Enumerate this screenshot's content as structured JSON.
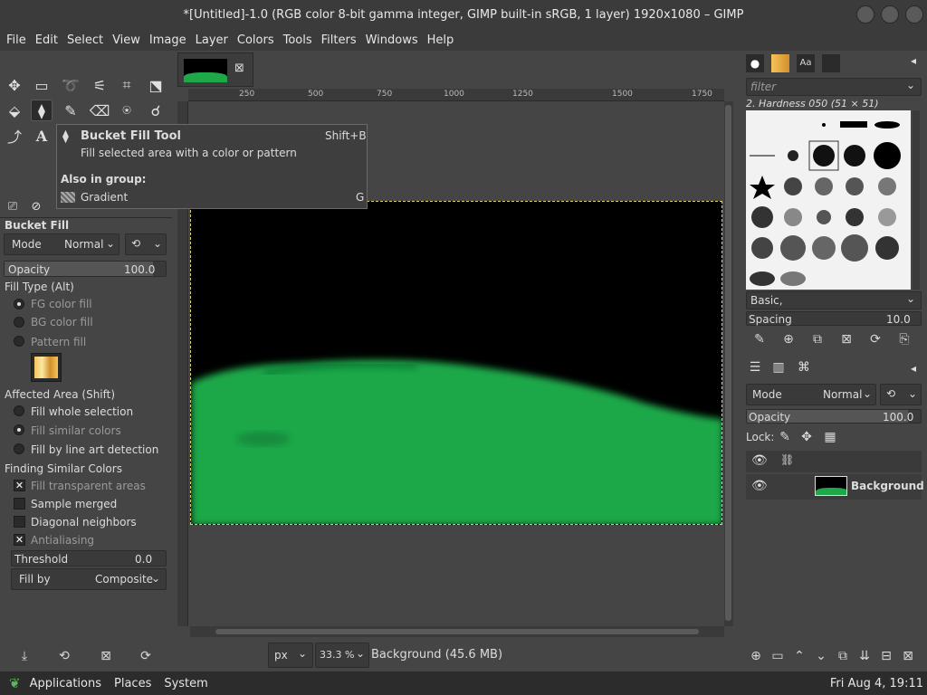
{
  "window": {
    "title": "*[Untitled]-1.0 (RGB color 8-bit gamma integer, GIMP built-in sRGB, 1 layer) 1920x1080 – GIMP"
  },
  "menu": [
    "File",
    "Edit",
    "Select",
    "View",
    "Image",
    "Layer",
    "Colors",
    "Tools",
    "Filters",
    "Windows",
    "Help"
  ],
  "tooltip": {
    "title": "Bucket Fill Tool",
    "shortcut": "Shift+B",
    "desc": "Fill selected area with a color or pattern",
    "group_label": "Also in group:",
    "group_item": "Gradient",
    "group_key": "G"
  },
  "tool_options": {
    "title": "Bucket Fill",
    "mode_label": "Mode",
    "mode_value": "Normal",
    "opacity_label": "Opacity",
    "opacity_value": "100.0",
    "fill_type_label": "Fill Type  (Alt)",
    "fill_types": [
      "FG color fill",
      "BG color fill",
      "Pattern fill"
    ],
    "affected_label": "Affected Area  (Shift)",
    "affected": [
      "Fill whole selection",
      "Fill similar colors",
      "Fill by line art detection"
    ],
    "similar_label": "Finding Similar Colors",
    "options": [
      "Fill transparent areas",
      "Sample merged",
      "Diagonal neighbors",
      "Antialiasing"
    ],
    "threshold_label": "Threshold",
    "threshold_value": "0.0",
    "fillby_label": "Fill by",
    "fillby_value": "Composite"
  },
  "ruler": [
    "250",
    "500",
    "750",
    "1000",
    "1250",
    "1500",
    "1750"
  ],
  "status": {
    "unit": "px",
    "zoom": "33.3 %",
    "info": "Background (45.6 MB)"
  },
  "brushes": {
    "filter_placeholder": "filter",
    "name": "2. Hardness 050 (51 × 51)",
    "tag": "Basic,",
    "spacing_label": "Spacing",
    "spacing_value": "10.0"
  },
  "layers": {
    "mode_label": "Mode",
    "mode_value": "Normal",
    "opacity_label": "Opacity",
    "opacity_value": "100.0",
    "lock_label": "Lock:",
    "layer_name": "Background"
  },
  "taskbar": {
    "apps": "Applications",
    "places": "Places",
    "system": "System",
    "clock": "Fri Aug  4, 19:11"
  },
  "colors": {
    "fill_green": "#1fa84a",
    "selection": "#d8d070"
  }
}
